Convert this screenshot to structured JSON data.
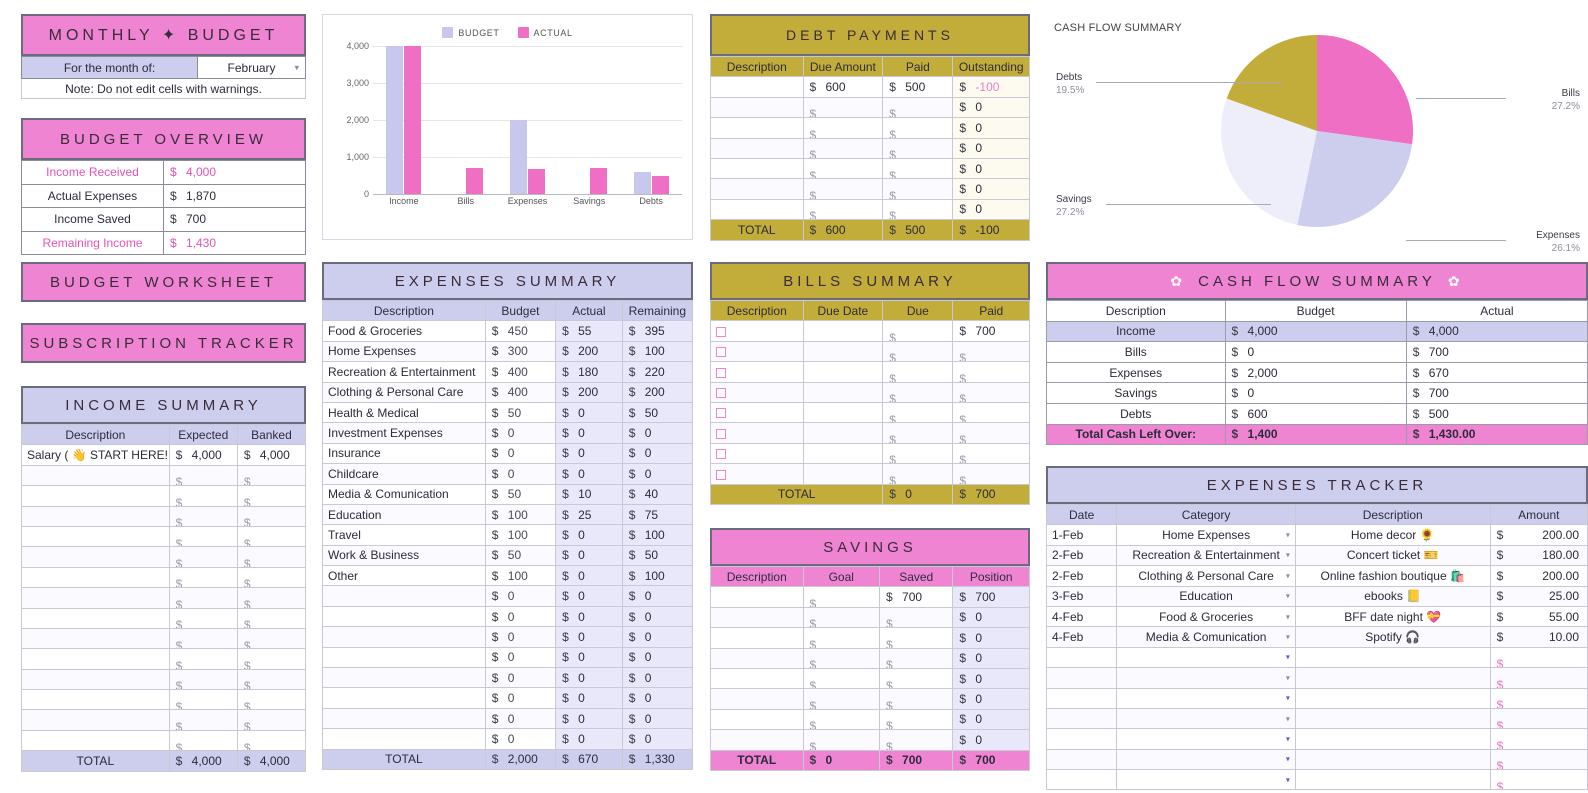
{
  "monthly_budget": {
    "title": "MONTHLY ✦ BUDGET",
    "month_label": "For the month of:",
    "month_value": "February",
    "note": "Note: Do not edit cells with warnings."
  },
  "budget_overview": {
    "title": "BUDGET OVERVIEW",
    "rows": [
      {
        "label": "Income Received",
        "sym": "$",
        "value": "4,000",
        "highlight": true
      },
      {
        "label": "Actual Expenses",
        "sym": "$",
        "value": "1,870",
        "highlight": false
      },
      {
        "label": "Income Saved",
        "sym": "$",
        "value": "700",
        "highlight": false
      },
      {
        "label": "Remaining Income",
        "sym": "$",
        "value": "1,430",
        "highlight": true
      }
    ]
  },
  "chart_data": [
    {
      "type": "bar",
      "title": "",
      "categories": [
        "Income",
        "Bills",
        "Expenses",
        "Savings",
        "Debts"
      ],
      "series": [
        {
          "name": "BUDGET",
          "color": "#c8c8ee",
          "values": [
            4000,
            0,
            2000,
            0,
            600
          ]
        },
        {
          "name": "ACTUAL",
          "color": "#ef6fc4",
          "values": [
            4000,
            700,
            670,
            700,
            500
          ]
        }
      ],
      "ylim": [
        0,
        4000
      ],
      "yticks": [
        "0",
        "1,000",
        "2,000",
        "3,000",
        "4,000"
      ],
      "xlabel": "",
      "ylabel": "",
      "grid": true,
      "legend_position": "top"
    },
    {
      "type": "pie",
      "title": "CASH FLOW SUMMARY",
      "labels": [
        "Bills",
        "Expenses",
        "Savings",
        "Debts"
      ],
      "percents": [
        "27.2%",
        "26.1%",
        "27.2%",
        "19.5%"
      ],
      "values": [
        27.2,
        26.1,
        27.2,
        19.5
      ],
      "colors": [
        "#ef6fc4",
        "#cdcdee",
        "#eeeefa",
        "#c2ac3a"
      ],
      "legend_position": "callout-labels"
    }
  ],
  "debt_payments": {
    "title": "DEBT PAYMENTS",
    "columns": [
      "Description",
      "Due Amount",
      "Paid",
      "Outstanding"
    ],
    "rows": [
      {
        "desc": "",
        "due": "600",
        "paid": "500",
        "out": "-100",
        "out_negative": true
      },
      {
        "desc": "",
        "due": "",
        "paid": "",
        "out": "0",
        "out_negative": false
      },
      {
        "desc": "",
        "due": "",
        "paid": "",
        "out": "0",
        "out_negative": false
      },
      {
        "desc": "",
        "due": "",
        "paid": "",
        "out": "0",
        "out_negative": false
      },
      {
        "desc": "",
        "due": "",
        "paid": "",
        "out": "0",
        "out_negative": false
      },
      {
        "desc": "",
        "due": "",
        "paid": "",
        "out": "0",
        "out_negative": false
      },
      {
        "desc": "",
        "due": "",
        "paid": "",
        "out": "0",
        "out_negative": false
      }
    ],
    "total": {
      "label": "TOTAL",
      "due": "600",
      "paid": "500",
      "out": "-100"
    }
  },
  "banners": {
    "budget_worksheet": "BUDGET WORKSHEET",
    "subscription_tracker": "SUBSCRIPTION TRACKER"
  },
  "income_summary": {
    "title": "INCOME SUMMARY",
    "columns": [
      "Description",
      "Expected",
      "Banked"
    ],
    "rows": [
      {
        "desc": "Salary ( 👋 START HERE! )",
        "expected": "4,000",
        "banked": "4,000"
      },
      {
        "desc": "",
        "expected": "",
        "banked": ""
      },
      {
        "desc": "",
        "expected": "",
        "banked": ""
      },
      {
        "desc": "",
        "expected": "",
        "banked": ""
      },
      {
        "desc": "",
        "expected": "",
        "banked": ""
      },
      {
        "desc": "",
        "expected": "",
        "banked": ""
      },
      {
        "desc": "",
        "expected": "",
        "banked": ""
      },
      {
        "desc": "",
        "expected": "",
        "banked": ""
      },
      {
        "desc": "",
        "expected": "",
        "banked": ""
      },
      {
        "desc": "",
        "expected": "",
        "banked": ""
      },
      {
        "desc": "",
        "expected": "",
        "banked": ""
      },
      {
        "desc": "",
        "expected": "",
        "banked": ""
      },
      {
        "desc": "",
        "expected": "",
        "banked": ""
      },
      {
        "desc": "",
        "expected": "",
        "banked": ""
      },
      {
        "desc": "",
        "expected": "",
        "banked": ""
      }
    ],
    "total": {
      "label": "TOTAL",
      "expected": "4,000",
      "banked": "4,000"
    }
  },
  "expenses_summary": {
    "title": "EXPENSES SUMMARY",
    "columns": [
      "Description",
      "Budget",
      "Actual",
      "Remaining"
    ],
    "rows": [
      {
        "desc": "Food & Groceries",
        "budget": "450",
        "actual": "55",
        "remaining": "395"
      },
      {
        "desc": "Home Expenses",
        "budget": "300",
        "actual": "200",
        "remaining": "100"
      },
      {
        "desc": "Recreation & Entertainment",
        "budget": "400",
        "actual": "180",
        "remaining": "220"
      },
      {
        "desc": "Clothing & Personal Care",
        "budget": "400",
        "actual": "200",
        "remaining": "200"
      },
      {
        "desc": "Health & Medical",
        "budget": "50",
        "actual": "0",
        "remaining": "50"
      },
      {
        "desc": "Investment Expenses",
        "budget": "0",
        "actual": "0",
        "remaining": "0"
      },
      {
        "desc": "Insurance",
        "budget": "0",
        "actual": "0",
        "remaining": "0"
      },
      {
        "desc": "Childcare",
        "budget": "0",
        "actual": "0",
        "remaining": "0"
      },
      {
        "desc": "Media & Comunication",
        "budget": "50",
        "actual": "10",
        "remaining": "40"
      },
      {
        "desc": "Education",
        "budget": "100",
        "actual": "25",
        "remaining": "75"
      },
      {
        "desc": "Travel",
        "budget": "100",
        "actual": "0",
        "remaining": "100"
      },
      {
        "desc": "Work & Business",
        "budget": "50",
        "actual": "0",
        "remaining": "50"
      },
      {
        "desc": "Other",
        "budget": "100",
        "actual": "0",
        "remaining": "100"
      },
      {
        "desc": "",
        "budget": "0",
        "actual": "0",
        "remaining": "0"
      },
      {
        "desc": "",
        "budget": "0",
        "actual": "0",
        "remaining": "0"
      },
      {
        "desc": "",
        "budget": "0",
        "actual": "0",
        "remaining": "0"
      },
      {
        "desc": "",
        "budget": "0",
        "actual": "0",
        "remaining": "0"
      },
      {
        "desc": "",
        "budget": "0",
        "actual": "0",
        "remaining": "0"
      },
      {
        "desc": "",
        "budget": "0",
        "actual": "0",
        "remaining": "0"
      },
      {
        "desc": "",
        "budget": "0",
        "actual": "0",
        "remaining": "0"
      },
      {
        "desc": "",
        "budget": "0",
        "actual": "0",
        "remaining": "0"
      }
    ],
    "total": {
      "label": "TOTAL",
      "budget": "2,000",
      "actual": "670",
      "remaining": "1,330"
    }
  },
  "bills_summary": {
    "title": "BILLS SUMMARY",
    "columns": [
      "Description",
      "Due Date",
      "Due",
      "Paid"
    ],
    "rows": [
      {
        "desc": "",
        "due_date": "",
        "due": "",
        "paid": "700"
      },
      {
        "desc": "",
        "due_date": "",
        "due": "",
        "paid": ""
      },
      {
        "desc": "",
        "due_date": "",
        "due": "",
        "paid": ""
      },
      {
        "desc": "",
        "due_date": "",
        "due": "",
        "paid": ""
      },
      {
        "desc": "",
        "due_date": "",
        "due": "",
        "paid": ""
      },
      {
        "desc": "",
        "due_date": "",
        "due": "",
        "paid": ""
      },
      {
        "desc": "",
        "due_date": "",
        "due": "",
        "paid": ""
      },
      {
        "desc": "",
        "due_date": "",
        "due": "",
        "paid": ""
      }
    ],
    "total": {
      "label": "TOTAL",
      "due": "0",
      "paid": "700"
    }
  },
  "savings": {
    "title": "SAVINGS",
    "columns": [
      "Description",
      "Goal",
      "Saved",
      "Position"
    ],
    "rows": [
      {
        "desc": "",
        "goal": "",
        "saved": "700",
        "position": "700"
      },
      {
        "desc": "",
        "goal": "",
        "saved": "",
        "position": "0"
      },
      {
        "desc": "",
        "goal": "",
        "saved": "",
        "position": "0"
      },
      {
        "desc": "",
        "goal": "",
        "saved": "",
        "position": "0"
      },
      {
        "desc": "",
        "goal": "",
        "saved": "",
        "position": "0"
      },
      {
        "desc": "",
        "goal": "",
        "saved": "",
        "position": "0"
      },
      {
        "desc": "",
        "goal": "",
        "saved": "",
        "position": "0"
      },
      {
        "desc": "",
        "goal": "",
        "saved": "",
        "position": "0"
      }
    ],
    "total": {
      "label": "TOTAL",
      "goal": "0",
      "saved": "700",
      "position": "700"
    }
  },
  "cashflow_summary": {
    "title": "CASH FLOW SUMMARY",
    "flower_left": "✿",
    "flower_right": "✿",
    "columns": [
      "Description",
      "Budget",
      "Actual"
    ],
    "rows": [
      {
        "desc": "Income",
        "budget": "4,000",
        "actual": "4,000",
        "highlight": true
      },
      {
        "desc": "Bills",
        "budget": "0",
        "actual": "700",
        "highlight": false
      },
      {
        "desc": "Expenses",
        "budget": "2,000",
        "actual": "670",
        "highlight": false
      },
      {
        "desc": "Savings",
        "budget": "0",
        "actual": "700",
        "highlight": false
      },
      {
        "desc": "Debts",
        "budget": "600",
        "actual": "500",
        "highlight": false
      }
    ],
    "total": {
      "label": "Total Cash Left Over:",
      "budget": "1,400",
      "actual": "1,430.00"
    }
  },
  "expenses_tracker": {
    "title": "EXPENSES TRACKER",
    "columns": [
      "Date",
      "Category",
      "Description",
      "Amount"
    ],
    "rows": [
      {
        "date": "1-Feb",
        "category": "Home Expenses",
        "desc": "Home decor 🌻",
        "amount": "200.00"
      },
      {
        "date": "2-Feb",
        "category": "Recreation & Entertainment",
        "desc": "Concert ticket 🎫",
        "amount": "180.00"
      },
      {
        "date": "2-Feb",
        "category": "Clothing & Personal Care",
        "desc": "Online fashion boutique 🛍️",
        "amount": "200.00"
      },
      {
        "date": "3-Feb",
        "category": "Education",
        "desc": "ebooks 📒",
        "amount": "25.00"
      },
      {
        "date": "4-Feb",
        "category": "Food & Groceries",
        "desc": "BFF date night 💝",
        "amount": "55.00"
      },
      {
        "date": "4-Feb",
        "category": "Media & Comunication",
        "desc": "Spotify 🎧",
        "amount": "10.00"
      },
      {
        "date": "",
        "category": "",
        "desc": "",
        "amount": ""
      },
      {
        "date": "",
        "category": "",
        "desc": "",
        "amount": ""
      },
      {
        "date": "",
        "category": "",
        "desc": "",
        "amount": ""
      },
      {
        "date": "",
        "category": "",
        "desc": "",
        "amount": ""
      },
      {
        "date": "",
        "category": "",
        "desc": "",
        "amount": ""
      },
      {
        "date": "",
        "category": "",
        "desc": "",
        "amount": ""
      },
      {
        "date": "",
        "category": "",
        "desc": "",
        "amount": ""
      }
    ]
  },
  "colors": {
    "pink": "#ef85d2",
    "pink_strong": "#ef6fc4",
    "gold": "#c2ac3a",
    "lavender": "#cdcdee",
    "pale_lavender": "#e8e8fa",
    "cream": "#fdfbf0"
  }
}
